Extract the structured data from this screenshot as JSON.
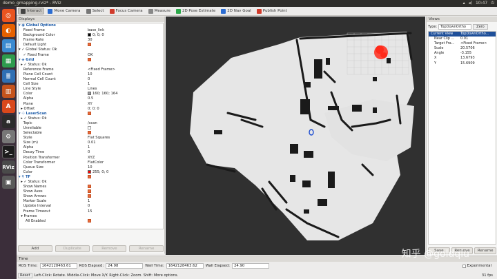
{
  "window": {
    "title": "demo_gmapping.rviz* - RViz",
    "clock": "10:47"
  },
  "toolbar": {
    "items": [
      {
        "label": "Interact",
        "icon": "cursor-icon",
        "active": true
      },
      {
        "label": "Move Camera",
        "icon": "move-camera-icon"
      },
      {
        "label": "Select",
        "icon": "select-icon"
      },
      {
        "label": "Focus Camera",
        "icon": "focus-camera-icon"
      },
      {
        "label": "Measure",
        "icon": "measure-icon"
      },
      {
        "label": "2D Pose Estimate",
        "icon": "pose-estimate-icon"
      },
      {
        "label": "2D Nav Goal",
        "icon": "nav-goal-icon"
      },
      {
        "label": "Publish Point",
        "icon": "publish-point-icon"
      }
    ]
  },
  "displays": {
    "header": "Displays",
    "rows": [
      {
        "k": "▾ ◉ Global Options",
        "v": "",
        "cls": "teal"
      },
      {
        "k": "    Fixed Frame",
        "v": "base_link"
      },
      {
        "k": "    Background Color",
        "v": "0; 0; 0",
        "swatch": "#000000"
      },
      {
        "k": "    Frame Rate",
        "v": "30"
      },
      {
        "k": "    Default Light",
        "v": "",
        "check": true
      },
      {
        "k": "▾ ✓ Global Status: Ok",
        "v": ""
      },
      {
        "k": "    ✓ Fixed Frame",
        "v": "OK"
      },
      {
        "k": "▾ ◈ Grid",
        "v": "",
        "cls": "teal",
        "check": true
      },
      {
        "k": "  ▸ ✓ Status: Ok",
        "v": ""
      },
      {
        "k": "    Reference Frame",
        "v": "<Fixed Frame>"
      },
      {
        "k": "    Plane Cell Count",
        "v": "10"
      },
      {
        "k": "    Normal Cell Count",
        "v": "0"
      },
      {
        "k": "    Cell Size",
        "v": "1"
      },
      {
        "k": "    Line Style",
        "v": "Lines"
      },
      {
        "k": "    Color",
        "v": "160; 160; 164",
        "swatch": "#a0a0a4"
      },
      {
        "k": "    Alpha",
        "v": "0.5"
      },
      {
        "k": "    Plane",
        "v": "XY"
      },
      {
        "k": "  ▸ Offset",
        "v": "0; 0; 0"
      },
      {
        "k": "▾ ⁘ LaserScan",
        "v": "",
        "cls": "teal",
        "check": true
      },
      {
        "k": "  ▸ ✓ Status: Ok",
        "v": ""
      },
      {
        "k": "    Topic",
        "v": "/scan"
      },
      {
        "k": "    Unreliable",
        "v": "",
        "check": false
      },
      {
        "k": "    Selectable",
        "v": "",
        "check": true
      },
      {
        "k": "    Style",
        "v": "Flat Squares"
      },
      {
        "k": "    Size (m)",
        "v": "0.01"
      },
      {
        "k": "    Alpha",
        "v": "1"
      },
      {
        "k": "    Decay Time",
        "v": "0"
      },
      {
        "k": "    Position Transformer",
        "v": "XYZ"
      },
      {
        "k": "    Color Transformer",
        "v": "FlatColor"
      },
      {
        "k": "    Queue Size",
        "v": "10"
      },
      {
        "k": "    Color",
        "v": "255; 0; 0",
        "swatch": "#ff0000"
      },
      {
        "k": "▾ ⚲ TF",
        "v": "",
        "cls": "teal",
        "check": true
      },
      {
        "k": "  ▸ ✓ Status: Ok",
        "v": ""
      },
      {
        "k": "    Show Names",
        "v": "",
        "check": true
      },
      {
        "k": "    Show Axes",
        "v": "",
        "check": true
      },
      {
        "k": "    Show Arrows",
        "v": "",
        "check": true
      },
      {
        "k": "    Marker Scale",
        "v": "1"
      },
      {
        "k": "    Update Interval",
        "v": "0"
      },
      {
        "k": "    Frame Timeout",
        "v": "15"
      },
      {
        "k": "  ▾ Frames",
        "v": ""
      },
      {
        "k": "      All Enabled",
        "v": "",
        "check": true
      }
    ],
    "buttons": [
      "Add",
      "Duplicate",
      "Remove",
      "Rename"
    ]
  },
  "views": {
    "header": "Views",
    "type_label": "Type:",
    "type_value": "TopDownOrtho",
    "zero_label": "Zero",
    "head_k": "Current View",
    "head_v": "TopDownOrtho...",
    "rows": [
      {
        "k": "Near Clip ...",
        "v": "0.01"
      },
      {
        "k": "Target Fra...",
        "v": "<Fixed Frame>"
      },
      {
        "k": "Scale",
        "v": "20.5706"
      },
      {
        "k": "Angle",
        "v": "-3.155"
      },
      {
        "k": "X",
        "v": "13.6793"
      },
      {
        "k": "Y",
        "v": "15.6909"
      }
    ],
    "buttons": [
      "Save",
      "Remove",
      "Rename"
    ]
  },
  "time": {
    "header": "Time",
    "ros_time_label": "ROS Time:",
    "ros_time": "1642128463.61",
    "ros_elapsed_label": "ROS Elapsed:",
    "ros_elapsed": "24.98",
    "wall_time_label": "Wall Time:",
    "wall_time": "1642128463.62",
    "wall_elapsed_label": "Wall Elapsed:",
    "wall_elapsed": "24.90",
    "experimental_label": "Experimental"
  },
  "status_bar": {
    "reset": "Reset",
    "hint": "Left-Click: Rotate. Middle-Click: Move X/Y. Right-Click: Zoom. Shift: More options.",
    "fps": "31 fps"
  },
  "watermark": "知乎 @goldqiu",
  "colors": {
    "laser": "#ff2a1a",
    "map_free": "#e6e6e6",
    "map_wall": "#1a1a1a",
    "map_unknown": "#303030",
    "robot": "#1f4fd1"
  }
}
